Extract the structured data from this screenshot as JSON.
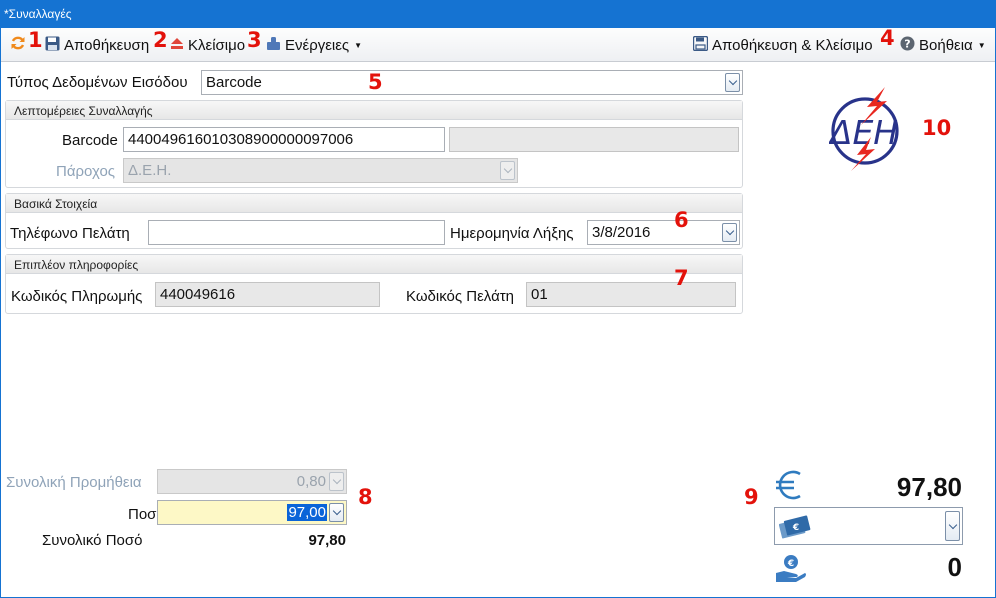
{
  "window": {
    "title": "*Συναλλαγές"
  },
  "toolbar": {
    "save_label": "Αποθήκευση",
    "close_label": "Κλείσιμο",
    "actions_label": "Ενέργειες",
    "save_close_label": "Αποθήκευση & Κλείσιμο",
    "help_label": "Βοήθεια"
  },
  "input_type": {
    "label": "Τύπος Δεδομένων Εισόδου",
    "value": "Barcode"
  },
  "details": {
    "header": "Λεπτομέρειες Συναλλαγής",
    "barcode_label": "Barcode",
    "barcode_value": "440049616010308900000097006",
    "barcode_extra": "",
    "provider_label": "Πάροχος",
    "provider_value": "Δ.Ε.Η."
  },
  "basic": {
    "header": "Βασικά Στοιχεία",
    "phone_label": "Τηλέφωνο Πελάτη",
    "phone_value": "",
    "expiry_label": "Ημερομηνία Λήξης",
    "expiry_value": "3/8/2016"
  },
  "more": {
    "header": "Επιπλέον πληροφορίες",
    "payment_code_label": "Κωδικός Πληρωμής",
    "payment_code_value": "440049616",
    "customer_code_label": "Κωδικός Πελάτη",
    "customer_code_value": "01"
  },
  "totals": {
    "commission_label": "Συνολική Προμήθεια",
    "commission_value": "0,80",
    "amount_label": "Ποσό",
    "amount_value": "97,00",
    "total_label": "Συνολικό Ποσό",
    "total_value": "97,80"
  },
  "payment": {
    "euro_amount": "97,80",
    "method_value": "",
    "change_amount": "0"
  },
  "logo": {
    "text": "ΔΕΗ"
  },
  "markers": [
    "1",
    "2",
    "3",
    "4",
    "5",
    "6",
    "7",
    "8",
    "9",
    "10"
  ],
  "colors": {
    "titlebar": "#1573d2",
    "marker": "#e3120b",
    "logo_blue": "#28338a",
    "logo_red": "#e8271f",
    "selection": "#0a64d8",
    "amount_bg": "#fdf8c6"
  }
}
